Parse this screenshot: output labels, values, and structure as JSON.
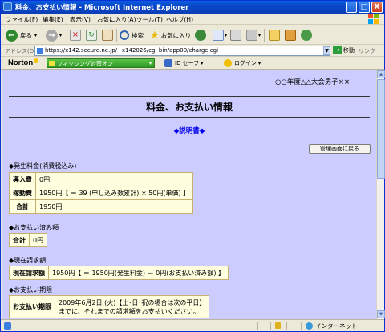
{
  "window": {
    "title": "料金、お支払い情報 - Microsoft Internet Explorer",
    "buttons": {
      "minimize": "_",
      "maximize": "□",
      "close": "X"
    }
  },
  "menu": [
    "ファイル(F)",
    "編集(E)",
    "表示(V)",
    "お気に入り(A)",
    "ツール(T)",
    "ヘルプ(H)"
  ],
  "toolbar": {
    "back": "戻る",
    "search": "検索",
    "favorites": "お気に入り"
  },
  "address": {
    "label": "アドレス(D)",
    "url": "https://x142.secure.ne.jp/~x142026/cgi-bin/app00/charge.cgi",
    "go": "移動",
    "links": "リンク"
  },
  "norton": {
    "logo": "Norton",
    "phishing": "フィッシング対策オン",
    "idsafe": "ID セーフ",
    "login": "ログイン"
  },
  "page": {
    "event_name": "○○年度△△大会男子××",
    "title": "料金、お支払い情報",
    "manual_link": "◆説明書◆",
    "back_button": "管理画面に戻る",
    "fees": {
      "heading": "◆発生料金(消費税込み)",
      "rows": [
        {
          "label": "導入費",
          "value": "0円"
        },
        {
          "label": "稼動費",
          "value": "1950円【 ＝ 39 (申し込み数累計) × 50円(単価) 】"
        },
        {
          "label": "合計",
          "value": "1950円"
        }
      ]
    },
    "paid": {
      "heading": "◆お支払い済み額",
      "rows": [
        {
          "label": "合計",
          "value": "0円"
        }
      ]
    },
    "current": {
      "heading": "◆現在請求額",
      "rows": [
        {
          "label": "現在請求額",
          "value": "1950円【 ＝ 1950円(発生料金) － 0円(お支払い済み額) 】"
        }
      ]
    },
    "deadline": {
      "heading": "◆お支払い期限",
      "label": "お支払い期限",
      "line1": "2009年6月2日 (火)【土･日･祝の場合は次の平日】",
      "line2": "までに、それまでの請求額をお支払いください。"
    }
  },
  "status": {
    "zone": "インターネット"
  },
  "colors": {
    "content_bg": "#ccccff",
    "table_bg": "#ffffe0",
    "link": "#0000ee",
    "titlebar": "#0846c8"
  }
}
